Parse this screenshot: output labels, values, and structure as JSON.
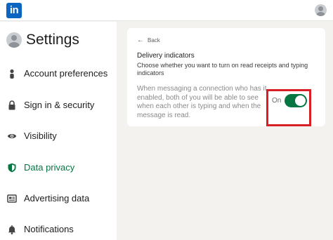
{
  "app": {
    "logo_text": "in",
    "brand_color": "#0a66c2"
  },
  "sidebar": {
    "title": "Settings",
    "items": [
      {
        "label": "Account preferences",
        "icon": "person-icon",
        "active": false
      },
      {
        "label": "Sign in & security",
        "icon": "lock-icon",
        "active": false
      },
      {
        "label": "Visibility",
        "icon": "eye-icon",
        "active": false
      },
      {
        "label": "Data privacy",
        "icon": "shield-icon",
        "active": true
      },
      {
        "label": "Advertising data",
        "icon": "newspaper-icon",
        "active": false
      },
      {
        "label": "Notifications",
        "icon": "bell-icon",
        "active": false
      }
    ],
    "active_color": "#057642"
  },
  "panel": {
    "back_label": "Back",
    "title": "Delivery indicators",
    "description": "Choose whether you want to turn on read receipts and typing indicators",
    "setting_text": "When messaging a connection who has it enabled, both of you will be able to see when each other is typing and when the message is read.",
    "toggle": {
      "state_label": "On",
      "enabled": true,
      "color": "#057642"
    },
    "highlight_color": "#d81f26"
  }
}
